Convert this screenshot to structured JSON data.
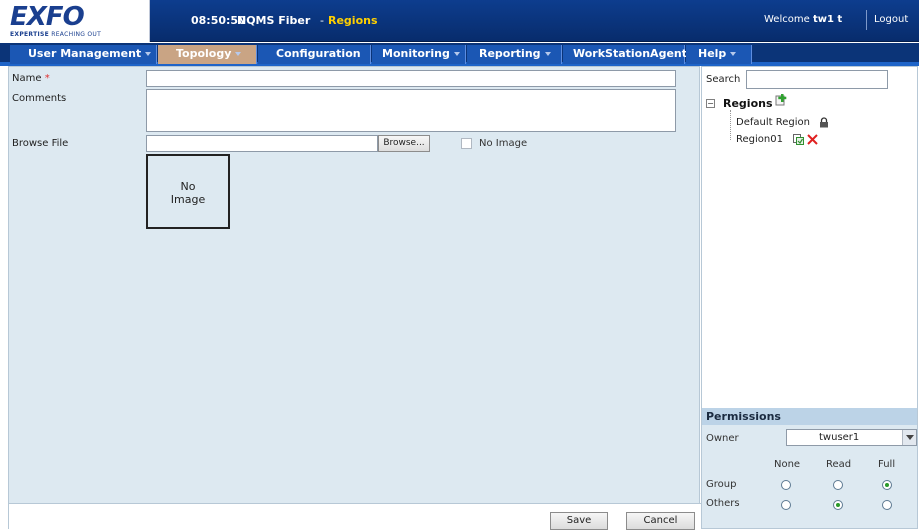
{
  "header": {
    "logo_text": "EXFO",
    "logo_tagline_1": "EXPERTISE",
    "logo_tagline_2": " REACHING OUT",
    "time": "08:50:50",
    "app": "NQMS Fiber",
    "separator": "-",
    "page": "Regions",
    "welcome": "Welcome",
    "user": "tw1 t",
    "logout": "Logout"
  },
  "nav": {
    "items": [
      {
        "label": "User Management"
      },
      {
        "label": "Topology"
      },
      {
        "label": "Configuration"
      },
      {
        "label": "Monitoring"
      },
      {
        "label": "Reporting"
      },
      {
        "label": "WorkStationAgent"
      },
      {
        "label": "Help"
      }
    ],
    "active": "Topology"
  },
  "form": {
    "name_label": "Name",
    "required_mark": "*",
    "name_value": "",
    "comments_label": "Comments",
    "comments_value": "",
    "browse_label": "Browse File",
    "browse_value": "",
    "browse_button": "Browse...",
    "no_image_checkbox_label": "No Image",
    "no_image_checked": false,
    "image_placeholder_line1": "No",
    "image_placeholder_line2": "Image",
    "save_button": "Save",
    "cancel_button": "Cancel"
  },
  "sidebar": {
    "search_label": "Search",
    "search_value": "",
    "tree_toggle": "−",
    "tree_root": "Regions",
    "tree_items": [
      {
        "label": "Default Region",
        "icon": "lock-icon"
      },
      {
        "label": "Region01",
        "icons": [
          "edit-icon",
          "delete-icon"
        ]
      }
    ]
  },
  "permissions": {
    "title": "Permissions",
    "owner_label": "Owner",
    "owner_value": "twuser1",
    "columns": [
      "None",
      "Read",
      "Full"
    ],
    "rows": [
      {
        "label": "Group",
        "selected": "Full"
      },
      {
        "label": "Others",
        "selected": "Read"
      }
    ]
  },
  "colors": {
    "header_bg": "#0d3d8e",
    "nav_item": "#1b57b4",
    "nav_active": "#c9a484",
    "page_title": "#ffd000",
    "form_bg": "#dde9f1",
    "required": "#e03030",
    "delete": "#e02020"
  }
}
